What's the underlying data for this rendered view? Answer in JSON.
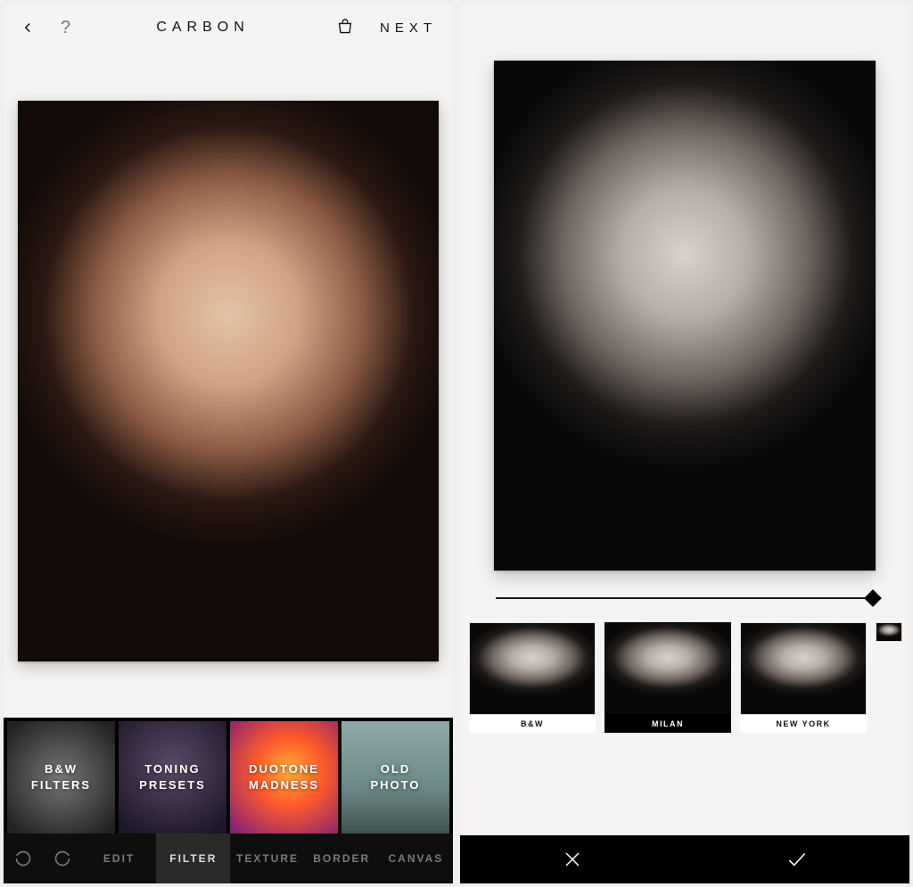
{
  "left": {
    "topbar": {
      "title": "CARBON",
      "next": "NEXT",
      "icons": {
        "back": "back-chevron",
        "help": "question-mark",
        "cart": "shopping-cart"
      }
    },
    "categories": [
      {
        "id": "bw-filters",
        "label": "B&W\nFILTERS",
        "style": "bw"
      },
      {
        "id": "toning-presets",
        "label": "TONING\nPRESETS",
        "style": "ton"
      },
      {
        "id": "duotone-madness",
        "label": "DUOTONE\nMADNESS",
        "style": "duo"
      },
      {
        "id": "old-photo",
        "label": "OLD\nPHOTO",
        "style": "old"
      }
    ],
    "tabs": [
      {
        "id": "edit",
        "label": "EDIT",
        "active": false
      },
      {
        "id": "filter",
        "label": "FILTER",
        "active": true
      },
      {
        "id": "texture",
        "label": "TEXTURE",
        "active": false
      },
      {
        "id": "border",
        "label": "BORDER",
        "active": false
      },
      {
        "id": "canvas",
        "label": "CANVAS",
        "active": false
      }
    ],
    "history": {
      "undo": "undo",
      "redo": "redo"
    }
  },
  "right": {
    "slider_value": 100,
    "presets": [
      {
        "id": "bw",
        "label": "B&W",
        "active": false
      },
      {
        "id": "milan",
        "label": "MILAN",
        "active": true
      },
      {
        "id": "newyork",
        "label": "NEW YORK",
        "active": false
      }
    ],
    "confirm": {
      "cancel": "×",
      "accept": "✓"
    }
  }
}
